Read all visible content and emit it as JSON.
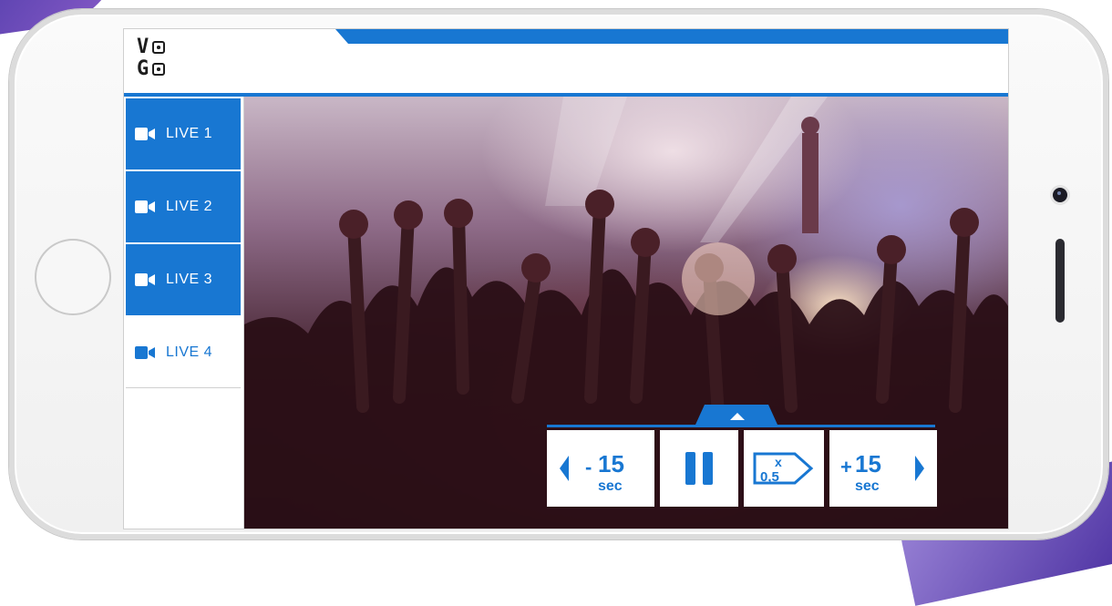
{
  "logo": {
    "line1_a": "V",
    "line2_a": "G"
  },
  "sidebar": {
    "items": [
      {
        "label": "LIVE 1",
        "icon": "video-camera-icon",
        "state": "active"
      },
      {
        "label": "LIVE 2",
        "icon": "video-camera-icon",
        "state": "active"
      },
      {
        "label": "LIVE 3",
        "icon": "video-camera-icon",
        "state": "active"
      },
      {
        "label": "LIVE 4",
        "icon": "video-camera-icon",
        "state": "inactive"
      }
    ]
  },
  "controls": {
    "rewind": {
      "sign": "-",
      "amount": "15",
      "unit": "sec",
      "icon": "rewind-15-icon"
    },
    "pause": {
      "icon": "pause-icon"
    },
    "speed": {
      "x": "x",
      "value": "0,5",
      "icon": "speed-tag-icon"
    },
    "forward": {
      "sign": "+",
      "amount": "15",
      "unit": "sec",
      "icon": "forward-15-icon"
    },
    "expand": {
      "icon": "chevron-up-icon"
    }
  },
  "colors": {
    "accent": "#1877d2",
    "white": "#ffffff",
    "purple": "#5b3fb0"
  }
}
